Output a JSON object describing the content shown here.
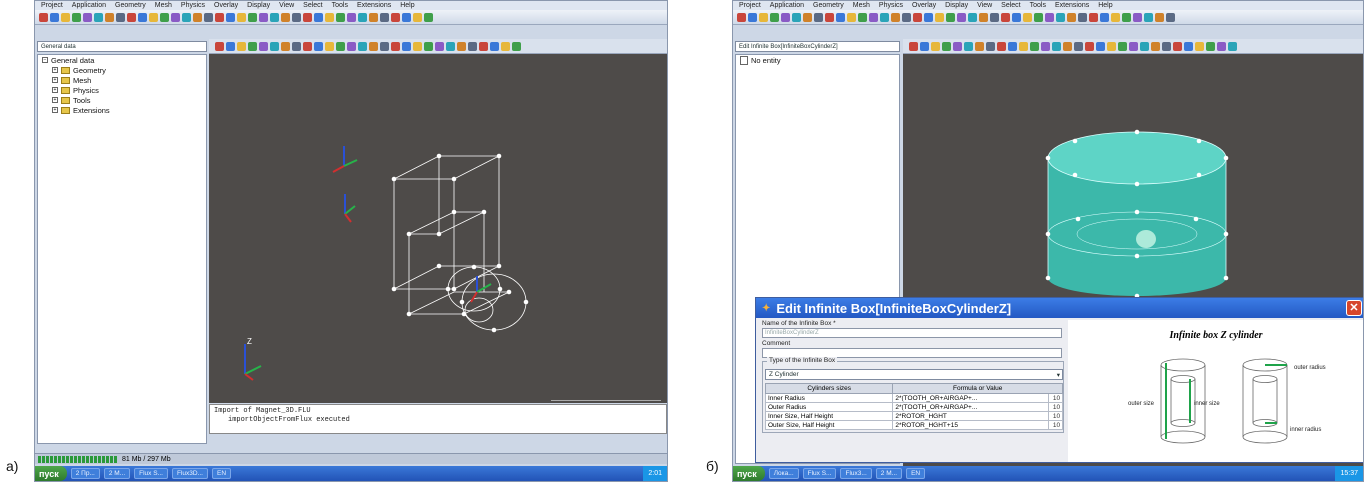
{
  "panel_a": {
    "label": "a)",
    "menu": [
      "Project",
      "Application",
      "Geometry",
      "Mesh",
      "Physics",
      "Overlay",
      "Display",
      "View",
      "Select",
      "Tools",
      "Extensions",
      "Help"
    ],
    "combo": "General data",
    "tree": [
      "Geometry",
      "Mesh",
      "Physics",
      "Tools",
      "Extensions"
    ],
    "console": [
      "Import of Magnet_3D.FLU",
      "importObjectFromFlux executed"
    ],
    "status_memory": "81 Mb / 297 Mb",
    "taskbar": {
      "start": "пуск",
      "buttons": [
        "2 Пр...",
        "2 M...",
        "Flux S...",
        "Flux3D...",
        "EN"
      ],
      "clock": "2:01"
    }
  },
  "panel_b": {
    "label": "б)",
    "menu": [
      "Project",
      "Application",
      "Geometry",
      "Mesh",
      "Physics",
      "Overlay",
      "Display",
      "View",
      "Select",
      "Tools",
      "Extensions",
      "Help"
    ],
    "combo": "Edit Infinite Box[InfiniteBoxCylinderZ]",
    "tree": [
      "No entity"
    ],
    "dialog": {
      "title": "Edit Infinite Box[InfiniteBoxCylinderZ]",
      "name_label": "Name of the Infinite Box *",
      "name_value": "InfiniteBoxCylinderZ",
      "comment_label": "Comment",
      "type_group": "Type of the Infinite Box",
      "type_value": "Z Cylinder",
      "table_headers": [
        "Cylinders sizes",
        "Formula or Value"
      ],
      "rows": [
        {
          "name": "Inner Radius",
          "value": "2*(TOOTH_OR+AIRGAP+..."
        },
        {
          "name": "Outer Radius",
          "value": "2*(TOOTH_OR+AIRGAP+..."
        },
        {
          "name": "Inner Size, Half Height",
          "value": "2*ROTOR_HGHT"
        },
        {
          "name": "Outer Size, Half Height",
          "value": "2*ROTOR_HGHT+15"
        }
      ],
      "preview_title": "Infinite box Z cylinder",
      "preview_labels": [
        "outer size",
        "inner size",
        "outer radius",
        "inner radius"
      ]
    },
    "taskbar": {
      "start": "пуск",
      "buttons": [
        "Лока...",
        "Flux S...",
        "Flux3...",
        "2 M...",
        "EN"
      ],
      "clock": "15:37"
    }
  },
  "colors": {
    "viewport": "#4e4b49",
    "cylinder": "#3cb8aa",
    "taskbar": "#2458c4",
    "start": "#3a9a38"
  }
}
